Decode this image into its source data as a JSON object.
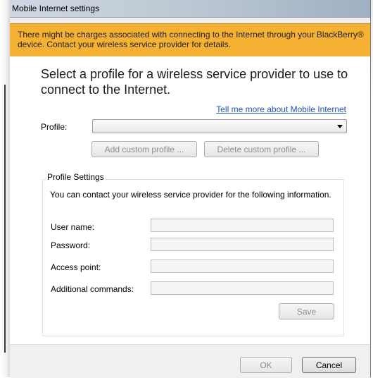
{
  "window": {
    "title": "Mobile Internet settings"
  },
  "banner": {
    "text": "There might be charges associated with connecting to the Internet through your BlackBerry® device. Contact your wireless service provider for details."
  },
  "main": {
    "heading": "Select a profile for a wireless service provider to use to connect to the Internet.",
    "more_link": "Tell me more about Mobile Internet",
    "profile_label": "Profile:",
    "profile_value": "",
    "add_button": "Add custom profile ...",
    "delete_button": "Delete custom profile ..."
  },
  "profile_settings": {
    "title": "Profile Settings",
    "description": "You can contact your wireless service provider for the following information.",
    "fields": [
      {
        "label": "User name:",
        "value": ""
      },
      {
        "label": "Password:",
        "value": ""
      },
      {
        "label": "Access point:",
        "value": ""
      },
      {
        "label": "Additional commands:",
        "value": ""
      }
    ],
    "save_button": "Save"
  },
  "footer": {
    "ok_button": "OK",
    "cancel_button": "Cancel"
  },
  "colors": {
    "banner": "#f4b132",
    "link": "#1a56c8"
  }
}
